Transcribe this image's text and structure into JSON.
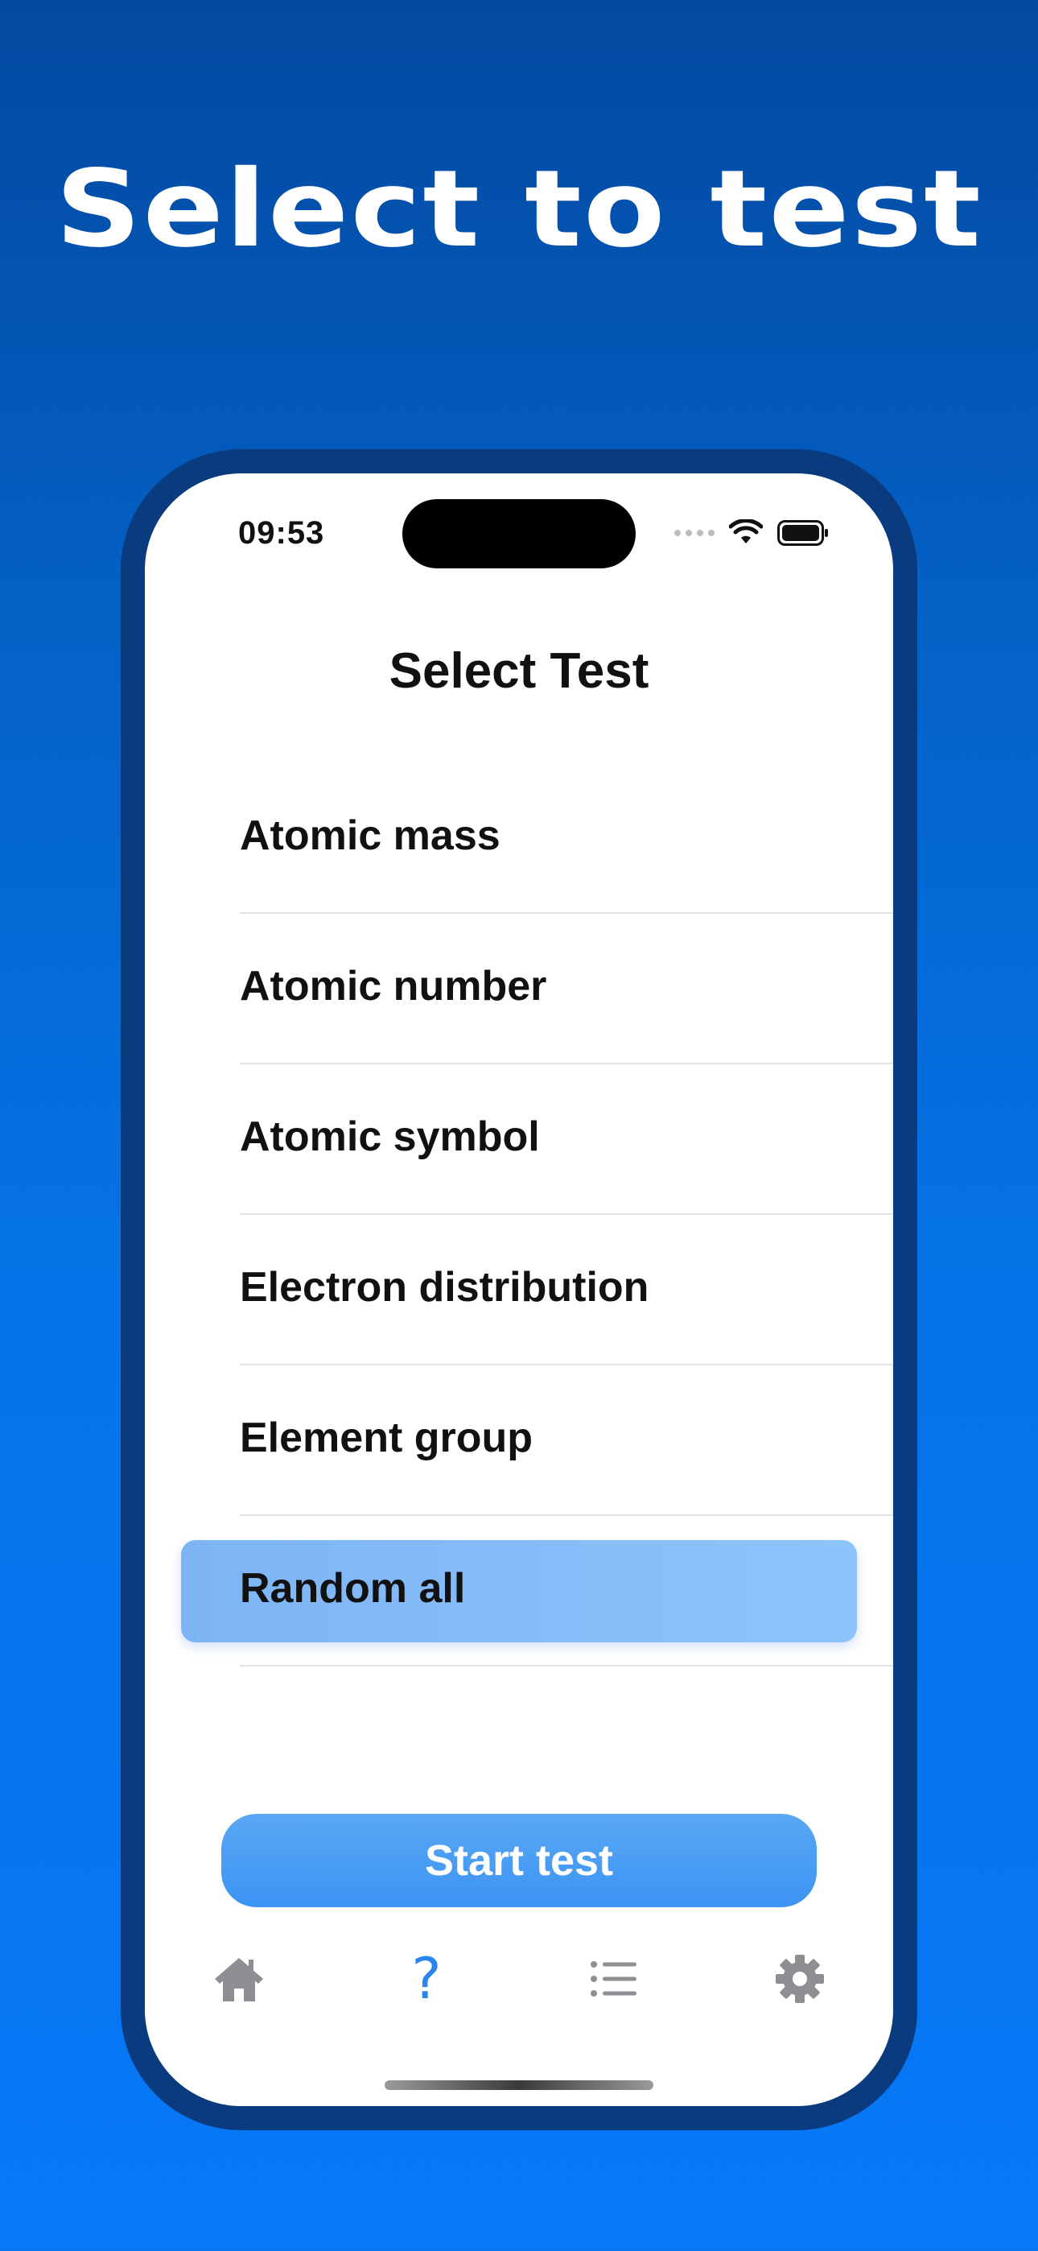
{
  "headline": "Select to test",
  "status_bar": {
    "time": "09:53",
    "icons": [
      "signal-dots-icon",
      "wifi-icon",
      "battery-icon"
    ]
  },
  "screen_title": "Select Test",
  "tests": [
    {
      "label": "Atomic mass",
      "selected": false
    },
    {
      "label": "Atomic number",
      "selected": false
    },
    {
      "label": "Atomic symbol",
      "selected": false
    },
    {
      "label": "Electron distribution",
      "selected": false
    },
    {
      "label": "Element group",
      "selected": false
    },
    {
      "label": "Random all",
      "selected": true
    }
  ],
  "start_button_label": "Start test",
  "tabs": [
    {
      "name": "home",
      "icon": "home-icon",
      "active": false
    },
    {
      "name": "test",
      "icon": "question-mark-icon",
      "glyph": "?",
      "active": true
    },
    {
      "name": "list",
      "icon": "list-icon",
      "active": false
    },
    {
      "name": "settings",
      "icon": "gear-icon",
      "active": false
    }
  ],
  "colors": {
    "background_top": "#0349a0",
    "background_bottom": "#0778f7",
    "phone_frame": "#0a3b7e",
    "selection": "#8dc4fb",
    "accent": "#2a86ee",
    "inactive_icon": "#8e8e93"
  }
}
